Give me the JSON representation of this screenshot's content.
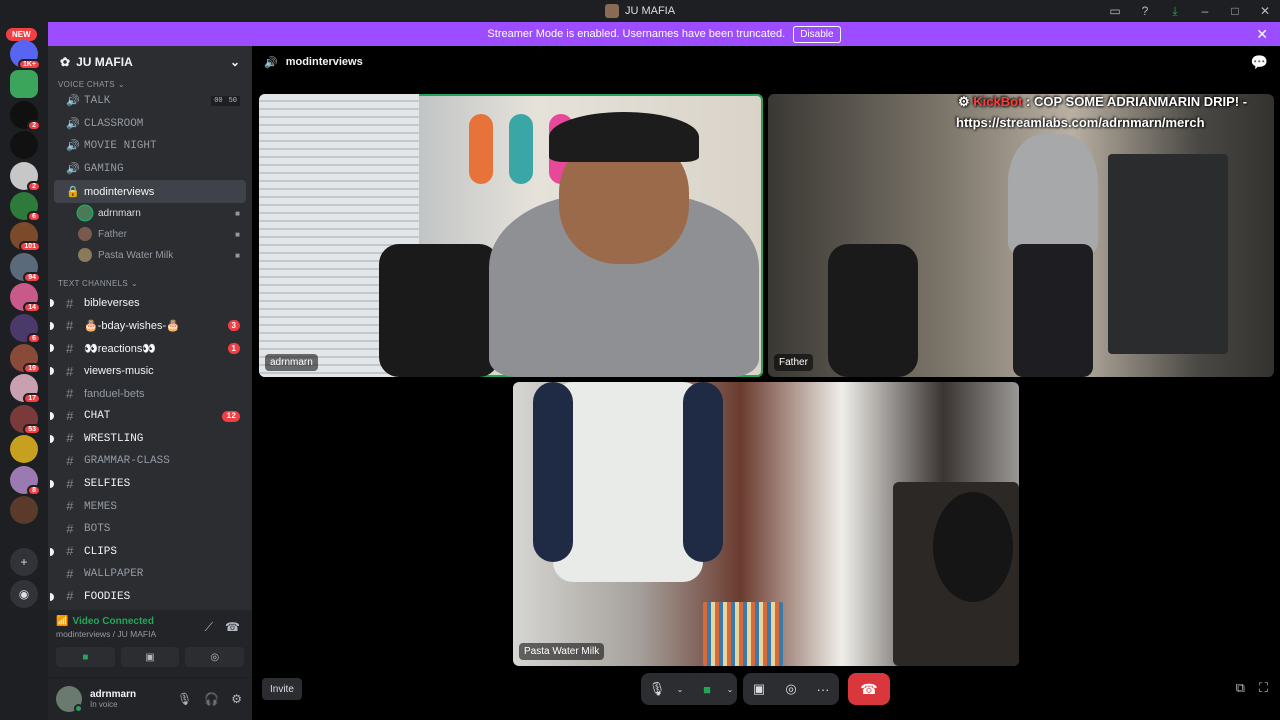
{
  "window": {
    "title": "JU MAFIA"
  },
  "banner": {
    "text": "Streamer Mode is enabled. Usernames have been truncated.",
    "disable_label": "Disable"
  },
  "guilds": {
    "new_label": "NEW",
    "items": [
      {
        "badge": "1K+"
      },
      {
        "badge": ""
      },
      {
        "badge": "2"
      },
      {
        "badge": ""
      },
      {
        "badge": "2"
      },
      {
        "badge": "6"
      },
      {
        "badge": "101"
      },
      {
        "badge": "94"
      },
      {
        "badge": "14"
      },
      {
        "badge": "6"
      },
      {
        "badge": "19"
      },
      {
        "badge": "17"
      },
      {
        "badge": "53"
      },
      {
        "badge": ""
      },
      {
        "badge": "8"
      },
      {
        "badge": ""
      }
    ]
  },
  "server": {
    "name": "JU MAFIA",
    "voice_category": "VOICE CHATS",
    "voice_channels": [
      {
        "name": "TALK",
        "cap_a": "00",
        "cap_b": "50"
      },
      {
        "name": "CLASSROOM"
      },
      {
        "name": "MOVIE NIGHT"
      },
      {
        "name": "GAMING"
      },
      {
        "name": "modinterviews",
        "active": true
      }
    ],
    "voice_users": [
      {
        "name": "adrnmarn",
        "speaking": true,
        "color": "#4a7a5a"
      },
      {
        "name": "Father",
        "color": "#7a5a4e"
      },
      {
        "name": "Pasta Water Milk",
        "color": "#8a7a5a"
      }
    ],
    "text_category": "TEXT CHANNELS",
    "text_channels": [
      {
        "name": "bibleverses",
        "unread": true
      },
      {
        "name": "🎂-bday-wishes-🎂",
        "unread": true,
        "badge": "3"
      },
      {
        "name": "👀reactions👀",
        "unread": true,
        "badge": "1"
      },
      {
        "name": "viewers-music",
        "unread": true
      },
      {
        "name": "fanduel-bets"
      },
      {
        "name": "CHAT",
        "unread": true,
        "badge": "12",
        "mono": true
      },
      {
        "name": "WRESTLING",
        "unread": true,
        "mono": true
      },
      {
        "name": "GRAMMAR-CLASS",
        "mono": true
      },
      {
        "name": "SELFIES",
        "unread": true,
        "mono": true
      },
      {
        "name": "MEMES",
        "mono": true
      },
      {
        "name": "BOTS",
        "mono": true
      },
      {
        "name": "CLIPS",
        "unread": true,
        "mono": true
      },
      {
        "name": "WALLPAPER",
        "mono": true
      },
      {
        "name": "FOODIES",
        "unread": true,
        "mono": true
      }
    ]
  },
  "voice_panel": {
    "status": "Video Connected",
    "location": "modinterviews / JU MAFIA"
  },
  "user_panel": {
    "username": "adrnmarn",
    "status": "In voice"
  },
  "call": {
    "channel_name": "modinterviews",
    "tiles": [
      {
        "name": "adrnmarn",
        "speaking": true
      },
      {
        "name": "Father"
      },
      {
        "name": "Pasta Water Milk"
      }
    ],
    "overlay": {
      "bot": "KickBot",
      "message": ": COP SOME ADRIANMARIN DRIP! -",
      "link": "https://streamlabs.com/adrnmarn/merch"
    },
    "invite_label": "Invite"
  }
}
